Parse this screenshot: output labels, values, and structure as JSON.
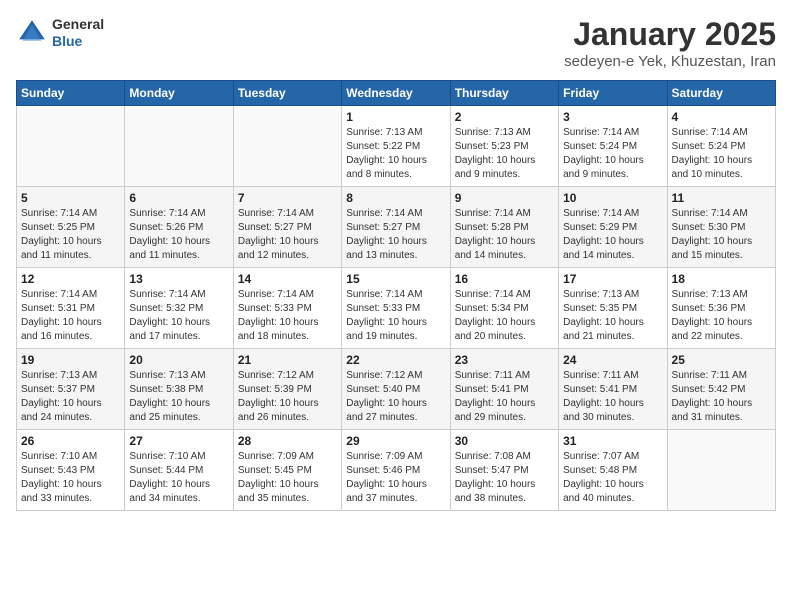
{
  "header": {
    "logo": {
      "general": "General",
      "blue": "Blue"
    },
    "title": "January 2025",
    "subtitle": "sedeyen-e Yek, Khuzestan, Iran"
  },
  "days_of_week": [
    "Sunday",
    "Monday",
    "Tuesday",
    "Wednesday",
    "Thursday",
    "Friday",
    "Saturday"
  ],
  "weeks": [
    [
      {
        "day": "",
        "info": ""
      },
      {
        "day": "",
        "info": ""
      },
      {
        "day": "",
        "info": ""
      },
      {
        "day": "1",
        "info": "Sunrise: 7:13 AM\nSunset: 5:22 PM\nDaylight: 10 hours\nand 8 minutes."
      },
      {
        "day": "2",
        "info": "Sunrise: 7:13 AM\nSunset: 5:23 PM\nDaylight: 10 hours\nand 9 minutes."
      },
      {
        "day": "3",
        "info": "Sunrise: 7:14 AM\nSunset: 5:24 PM\nDaylight: 10 hours\nand 9 minutes."
      },
      {
        "day": "4",
        "info": "Sunrise: 7:14 AM\nSunset: 5:24 PM\nDaylight: 10 hours\nand 10 minutes."
      }
    ],
    [
      {
        "day": "5",
        "info": "Sunrise: 7:14 AM\nSunset: 5:25 PM\nDaylight: 10 hours\nand 11 minutes."
      },
      {
        "day": "6",
        "info": "Sunrise: 7:14 AM\nSunset: 5:26 PM\nDaylight: 10 hours\nand 11 minutes."
      },
      {
        "day": "7",
        "info": "Sunrise: 7:14 AM\nSunset: 5:27 PM\nDaylight: 10 hours\nand 12 minutes."
      },
      {
        "day": "8",
        "info": "Sunrise: 7:14 AM\nSunset: 5:27 PM\nDaylight: 10 hours\nand 13 minutes."
      },
      {
        "day": "9",
        "info": "Sunrise: 7:14 AM\nSunset: 5:28 PM\nDaylight: 10 hours\nand 14 minutes."
      },
      {
        "day": "10",
        "info": "Sunrise: 7:14 AM\nSunset: 5:29 PM\nDaylight: 10 hours\nand 14 minutes."
      },
      {
        "day": "11",
        "info": "Sunrise: 7:14 AM\nSunset: 5:30 PM\nDaylight: 10 hours\nand 15 minutes."
      }
    ],
    [
      {
        "day": "12",
        "info": "Sunrise: 7:14 AM\nSunset: 5:31 PM\nDaylight: 10 hours\nand 16 minutes."
      },
      {
        "day": "13",
        "info": "Sunrise: 7:14 AM\nSunset: 5:32 PM\nDaylight: 10 hours\nand 17 minutes."
      },
      {
        "day": "14",
        "info": "Sunrise: 7:14 AM\nSunset: 5:33 PM\nDaylight: 10 hours\nand 18 minutes."
      },
      {
        "day": "15",
        "info": "Sunrise: 7:14 AM\nSunset: 5:33 PM\nDaylight: 10 hours\nand 19 minutes."
      },
      {
        "day": "16",
        "info": "Sunrise: 7:14 AM\nSunset: 5:34 PM\nDaylight: 10 hours\nand 20 minutes."
      },
      {
        "day": "17",
        "info": "Sunrise: 7:13 AM\nSunset: 5:35 PM\nDaylight: 10 hours\nand 21 minutes."
      },
      {
        "day": "18",
        "info": "Sunrise: 7:13 AM\nSunset: 5:36 PM\nDaylight: 10 hours\nand 22 minutes."
      }
    ],
    [
      {
        "day": "19",
        "info": "Sunrise: 7:13 AM\nSunset: 5:37 PM\nDaylight: 10 hours\nand 24 minutes."
      },
      {
        "day": "20",
        "info": "Sunrise: 7:13 AM\nSunset: 5:38 PM\nDaylight: 10 hours\nand 25 minutes."
      },
      {
        "day": "21",
        "info": "Sunrise: 7:12 AM\nSunset: 5:39 PM\nDaylight: 10 hours\nand 26 minutes."
      },
      {
        "day": "22",
        "info": "Sunrise: 7:12 AM\nSunset: 5:40 PM\nDaylight: 10 hours\nand 27 minutes."
      },
      {
        "day": "23",
        "info": "Sunrise: 7:11 AM\nSunset: 5:41 PM\nDaylight: 10 hours\nand 29 minutes."
      },
      {
        "day": "24",
        "info": "Sunrise: 7:11 AM\nSunset: 5:41 PM\nDaylight: 10 hours\nand 30 minutes."
      },
      {
        "day": "25",
        "info": "Sunrise: 7:11 AM\nSunset: 5:42 PM\nDaylight: 10 hours\nand 31 minutes."
      }
    ],
    [
      {
        "day": "26",
        "info": "Sunrise: 7:10 AM\nSunset: 5:43 PM\nDaylight: 10 hours\nand 33 minutes."
      },
      {
        "day": "27",
        "info": "Sunrise: 7:10 AM\nSunset: 5:44 PM\nDaylight: 10 hours\nand 34 minutes."
      },
      {
        "day": "28",
        "info": "Sunrise: 7:09 AM\nSunset: 5:45 PM\nDaylight: 10 hours\nand 35 minutes."
      },
      {
        "day": "29",
        "info": "Sunrise: 7:09 AM\nSunset: 5:46 PM\nDaylight: 10 hours\nand 37 minutes."
      },
      {
        "day": "30",
        "info": "Sunrise: 7:08 AM\nSunset: 5:47 PM\nDaylight: 10 hours\nand 38 minutes."
      },
      {
        "day": "31",
        "info": "Sunrise: 7:07 AM\nSunset: 5:48 PM\nDaylight: 10 hours\nand 40 minutes."
      },
      {
        "day": "",
        "info": ""
      }
    ]
  ]
}
